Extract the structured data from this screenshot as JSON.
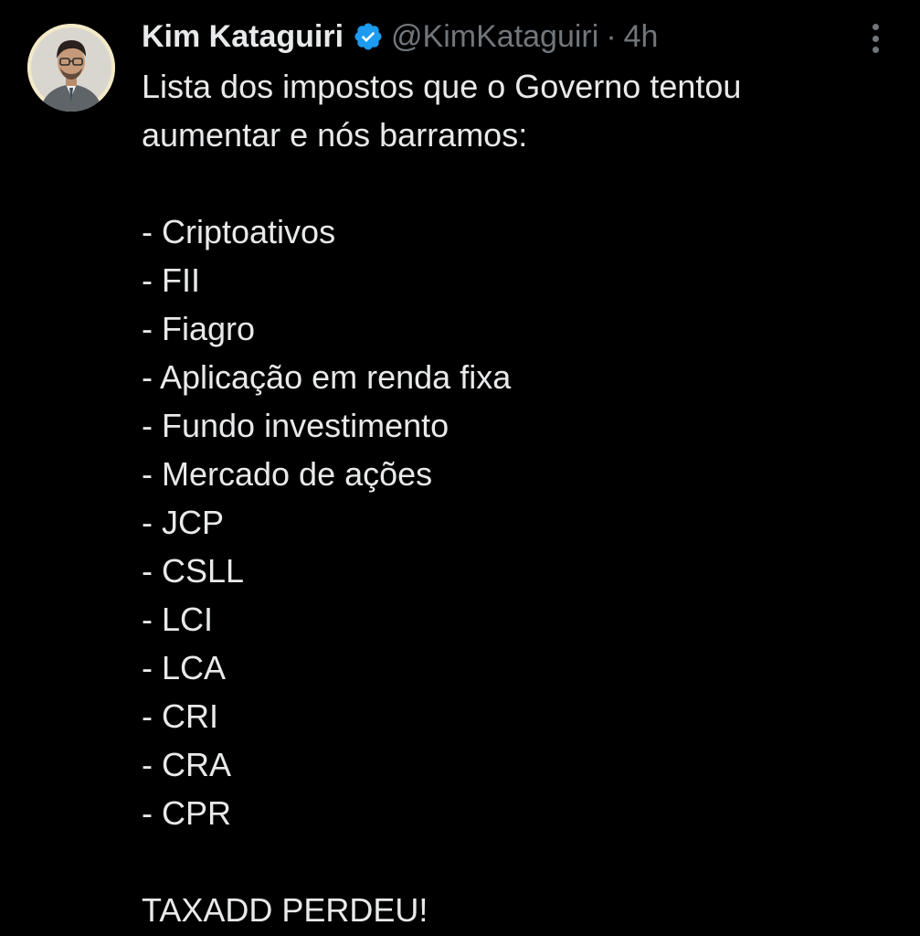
{
  "author": {
    "display_name": "Kim Kataguiri",
    "handle": "@KimKataguiri",
    "separator": "·",
    "time": "4h",
    "verified_color": "#1d9bf0",
    "avatar_icon": "profile-photo"
  },
  "menu": {
    "icon": "more-vertical-icon"
  },
  "tweet": {
    "intro_line_1": "Lista dos impostos que o Governo tentou",
    "intro_line_2": "aumentar e nós barramos:",
    "items": [
      "- Criptoativos",
      "- FII",
      "- Fiagro",
      "- Aplicação em renda fixa",
      "- Fundo investimento",
      "- Mercado de ações",
      "- JCP",
      "- CSLL",
      "- LCI",
      "- LCA",
      "- CRI",
      "- CRA",
      "- CPR"
    ],
    "closing": "TAXADD PERDEU!"
  },
  "colors": {
    "background": "#000000",
    "primary_text": "#e7e9ea",
    "secondary_text": "#71767b",
    "accent": "#1d9bf0"
  }
}
